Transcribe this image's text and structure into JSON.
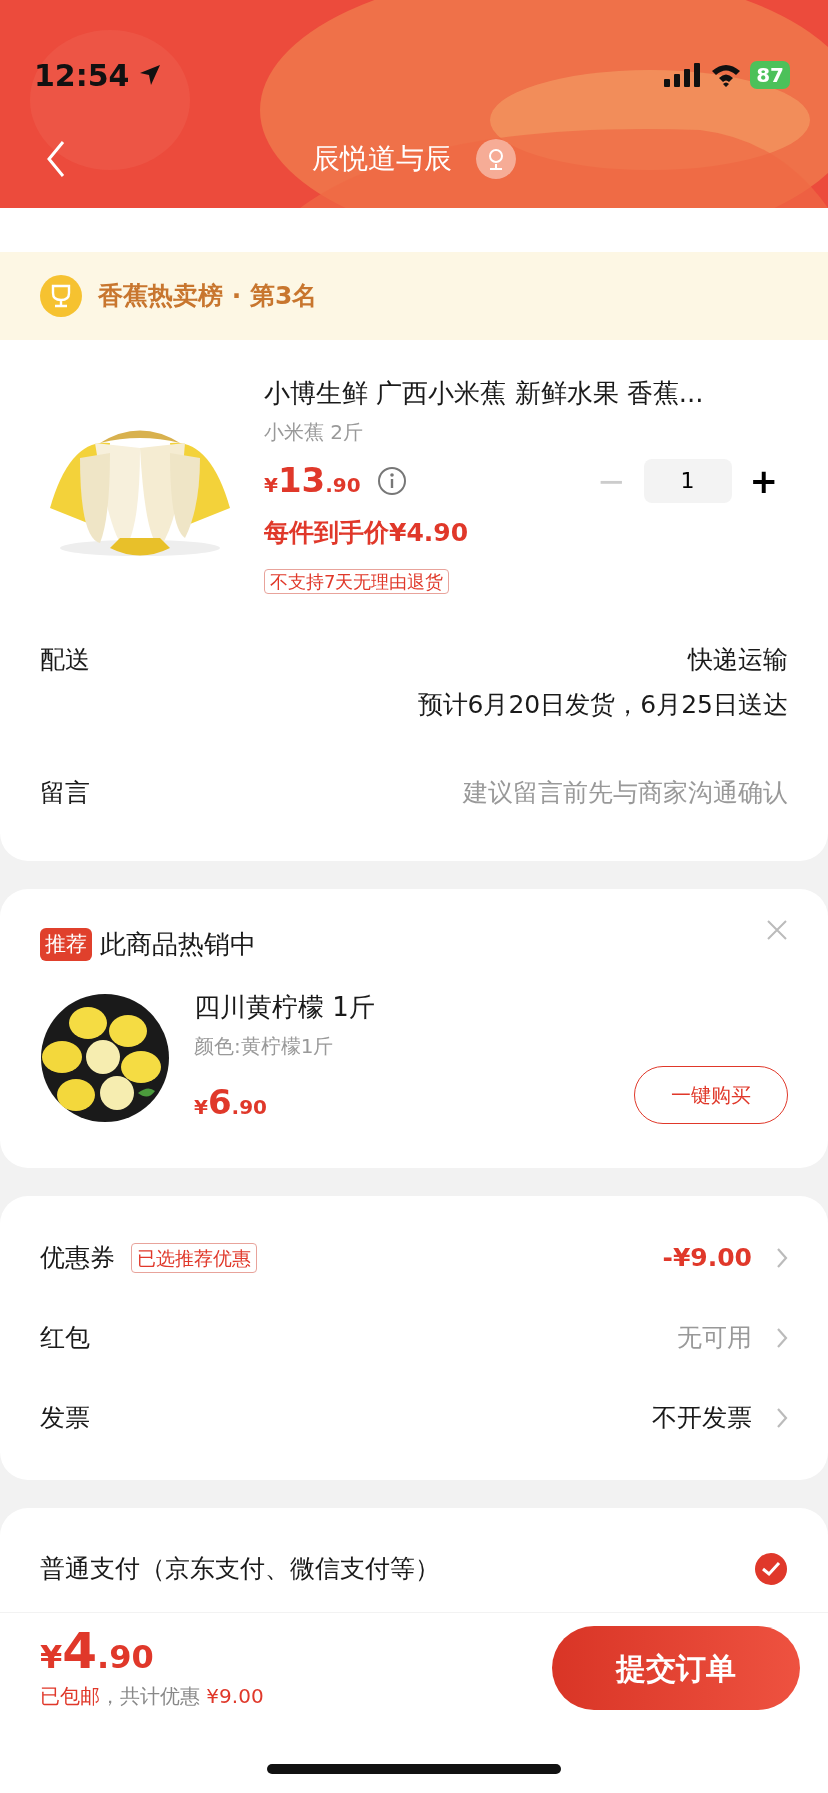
{
  "status_bar": {
    "time": "12:54",
    "battery": "87"
  },
  "header": {
    "title": "辰悦道与辰"
  },
  "rank_banner": {
    "text": "香蕉热卖榜 · 第3名"
  },
  "product": {
    "title": "小博生鲜 广西小米蕉 新鲜水果 香蕉...",
    "spec": "小米蕉 2斤",
    "price_symbol": "¥",
    "price_int": "13",
    "price_dec": ".90",
    "unit_price": "每件到手价¥4.90",
    "tag": "不支持7天无理由退货",
    "quantity": {
      "minus": "−",
      "value": "1",
      "plus": "+",
      "minus_disabled": true
    }
  },
  "delivery": [
    {
      "label": "配送",
      "lines": [
        "快递运输",
        "预计6月20日发货，6月25日送达"
      ],
      "kind": "text"
    },
    {
      "label": "留言",
      "placeholder": "建议留言前先与商家沟通确认",
      "kind": "input"
    }
  ],
  "recommend": {
    "badge": "推荐",
    "title": "此商品热销中",
    "item": {
      "name": "四川黄柠檬 1斤",
      "spec": "颜色:黄柠檬1斤",
      "price_symbol": "¥",
      "price_int": "6",
      "price_dec": ".90",
      "button": "一键购买"
    }
  },
  "discounts": [
    {
      "label": "优惠券",
      "tag": "已选推荐优惠",
      "value": "-¥9.00",
      "kind": "discount"
    },
    {
      "label": "红包",
      "value": "无可用",
      "kind": "none"
    },
    {
      "label": "发票",
      "value": "不开发票",
      "kind": "normal"
    }
  ],
  "payment": {
    "label": "普通支付（京东支付、微信支付等）",
    "checked": true
  },
  "footer": {
    "price_symbol": "¥",
    "price_int": "4",
    "price_dec": ".90",
    "shipping": "已包邮",
    "saving_label": "，共计优惠",
    "saving": "¥9.00",
    "submit": "提交订单"
  }
}
